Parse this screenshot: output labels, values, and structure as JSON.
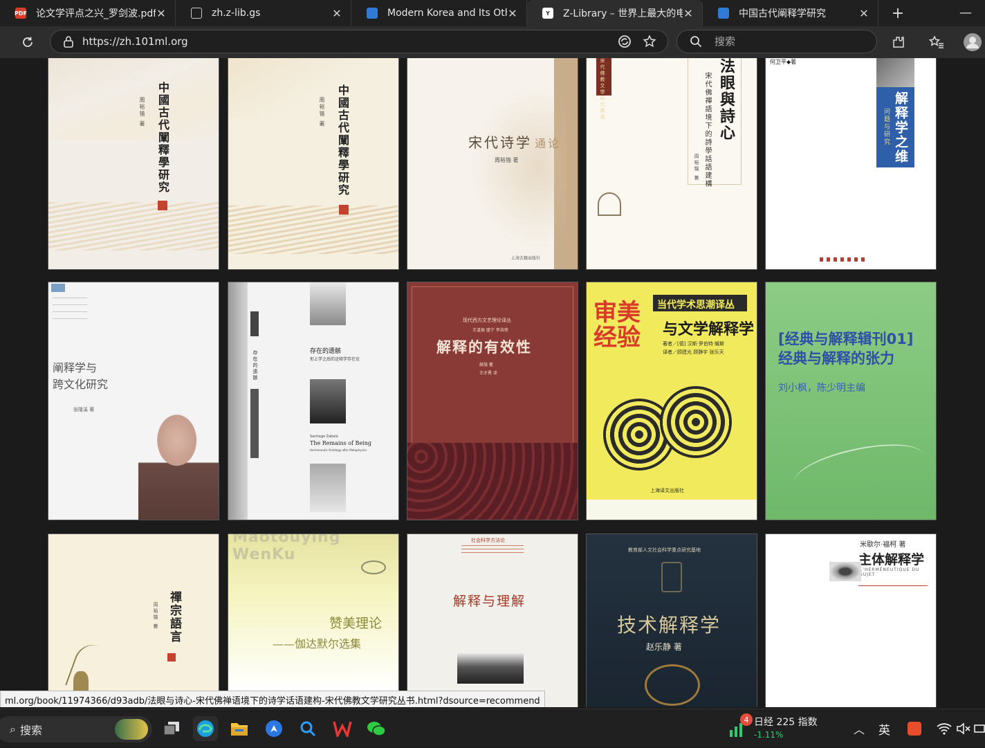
{
  "tabs": [
    {
      "title": "论文学评点之兴_罗剑波.pdf",
      "icon": "pdf-icon",
      "icon_label": "PDF",
      "color": "#d83b2a"
    },
    {
      "title": "zh.z-lib.gs",
      "icon": "document-icon",
      "icon_label": "",
      "color": "#5a5a5a"
    },
    {
      "title": "Modern Korea and Its Others: P",
      "icon": "book-icon",
      "icon_label": "",
      "color": "#2f7bd6"
    },
    {
      "title": "Z-Library – 世界上最大的电子图",
      "icon": "zlibrary-icon",
      "icon_label": "Y",
      "color": "#ffffff"
    },
    {
      "title": "中国古代阐释学研究",
      "icon": "book-icon",
      "icon_label": "",
      "color": "#2f7bd6"
    }
  ],
  "address": {
    "url": "https://zh.101ml.org"
  },
  "search": {
    "placeholder": "搜索"
  },
  "books": [
    {
      "title": "中國古代闡釋學研究",
      "author": "周裕锴 著",
      "bg": "#f2ede6"
    },
    {
      "title": "中國古代闡釋學研究",
      "author": "周裕锴 著",
      "bg": "#f5efe0"
    },
    {
      "title": "宋代诗学",
      "title2": "通论",
      "author": "周裕锴 著",
      "publisher": "上海古籍出版社",
      "bg": "#f7f3ec"
    },
    {
      "title": "法眼與詩心",
      "subtitle": "宋代佛禪語境下的詩學話語建構",
      "author": "周裕锴 著",
      "series": "宋代佛教文學研究叢書",
      "bg": "#fbf8f1"
    },
    {
      "title": "解释学之维",
      "subtitle": "问题与研究",
      "author": "何卫平◆著",
      "bg": "#ffffff"
    },
    {
      "title": "阐释学与",
      "title2": "跨文化研究",
      "author": "张隆溪 著",
      "bg": "#f4f4f4"
    },
    {
      "title": "存在的遗骸",
      "subtitle": "形上学之后的诠释学存在论",
      "en_title": "The Remains of Being",
      "en_subtitle": "Hermeneutic Ontology after Metaphysics",
      "en_author": "Santiago Zabala",
      "bg": "#f3f3f3"
    },
    {
      "title": "解释的有效性",
      "series": "现代西方文艺理论译丛",
      "editors": "王逢振 盛宁 李自修",
      "author": "赫施 著",
      "translator": "王才勇 译",
      "bg": "#8a3a36"
    },
    {
      "title": "审美",
      "title2": "经验",
      "subtitle": "与文学解释学",
      "series": "当代学术思潮译丛",
      "author": "著者／[德] 汉斯·罗伯特·耀斯",
      "translator": "译者／顾建光 顾静宇 张乐天",
      "publisher": "上海译文出版社",
      "bg": "#f0ea5c"
    },
    {
      "title": "[经典与解释辑刊01]",
      "title2": "经典与解释的张力",
      "author": "刘小枫，陈少明主编",
      "bg": "#7fc27a"
    },
    {
      "title": "禪宗語言",
      "author": "周裕锴 著",
      "bg": "#f6f0dc"
    },
    {
      "title": "赞美理论",
      "subtitle": "——伽达默尔选集",
      "series": "Maotouying WenKu",
      "bg": "#f4f2b8"
    },
    {
      "title": "解释与理解",
      "series": "社会科学方法论",
      "bg": "#f2f0ea"
    },
    {
      "title": "技术解释学",
      "author": "赵乐静 著",
      "series": "教育部人文社会科学重点研究基地",
      "bg": "#1f2b36"
    },
    {
      "title": "主体解释学",
      "author": "米歇尔·福柯 著",
      "fr_title": "L'HERMÉNEUTIQUE DU SUJET",
      "bg": "#ffffff"
    }
  ],
  "status_url": "ml.org/book/11974366/d93adb/法眼与诗心-宋代佛禅语境下的诗学话语建构-宋代佛教文学研究丛书.html?dsource=recommend",
  "taskbar": {
    "search_label": "搜索",
    "stock": {
      "name": "日经 225 指数",
      "change": "-1.11%",
      "badge": "4"
    },
    "ime": "英"
  }
}
